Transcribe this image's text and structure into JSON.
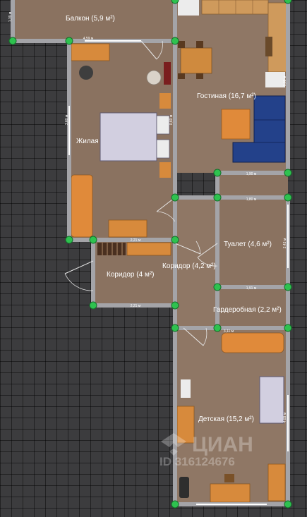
{
  "rooms": {
    "balcony": "Балкон (5,9 м²)",
    "living": "Гостиная (16,7 м²)",
    "bedroom": "Жилая",
    "toilet": "Туалет (4,6 м²)",
    "corridor_small": "Коридор (4 м²)",
    "corridor_main": "Коридор (4,2 м²)",
    "wardrobe": "Гардеробная (2,2 м²)",
    "kids": "Детская (15,2 м²)"
  },
  "dimensions": {
    "balcony_width": "4,59 м",
    "bedroom_height": "3,60 м",
    "bedroom_mid": "0,60 м",
    "living_width": "1,90 м",
    "toilet_width": "1,80 м",
    "toilet_height": "2,43 м",
    "corridor_small_top": "2,21 м",
    "corridor_small_bottom": "2,21 м",
    "wardrobe_top": "1,91 м",
    "wardrobe_bottom": "3,11 м",
    "kids_height": "4,89 м",
    "right_top": "1,02 м",
    "left_top": "1,39 м"
  },
  "watermark": {
    "brand": "ЦИАН",
    "id": "ID 316124676"
  }
}
